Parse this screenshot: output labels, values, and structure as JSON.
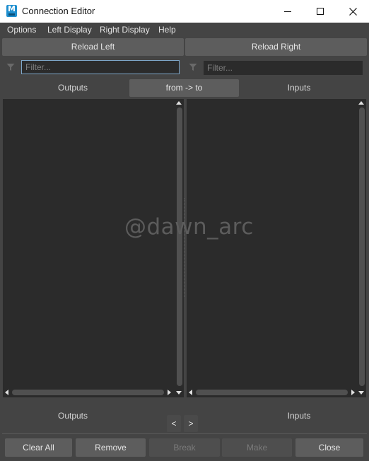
{
  "window": {
    "title": "Connection Editor",
    "app_icon": "maya-app-icon",
    "controls": [
      "minimize-icon",
      "maximize-icon",
      "close-icon"
    ]
  },
  "menu": {
    "items": [
      "Options",
      "Left Display",
      "Right Display",
      "Help"
    ]
  },
  "reload": {
    "left_label": "Reload Left",
    "right_label": "Reload Right"
  },
  "filters": {
    "left_placeholder": "Filter...",
    "left_value": "",
    "right_placeholder": "Filter...",
    "right_value": "",
    "icon": "funnel-icon"
  },
  "columns": {
    "left_header": "Outputs",
    "right_header": "Inputs",
    "direction_label": "from -> to",
    "left_footer": "Outputs",
    "right_footer": "Inputs"
  },
  "watermark": "@dawn_arc",
  "nav": {
    "prev_label": "<",
    "next_label": ">"
  },
  "actions": {
    "clear_all": "Clear All",
    "remove": "Remove",
    "break": "Break",
    "make": "Make",
    "close": "Close"
  },
  "colors": {
    "background": "#444444",
    "panel": "#2b2b2b",
    "button": "#5d5d5d",
    "focus_border": "#7fa7c9",
    "app_icon": "#1f8fcf"
  }
}
